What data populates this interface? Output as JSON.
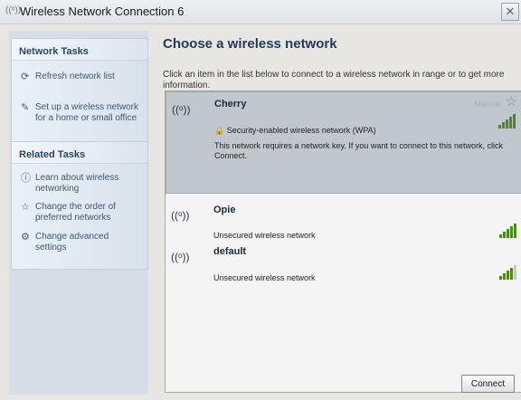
{
  "window": {
    "title": "Wireless Network Connection 6",
    "close_glyph": "✕",
    "title_icon": "wireless-icon"
  },
  "sidebar": {
    "network_tasks": {
      "title": "Network Tasks",
      "items": [
        {
          "label": "Refresh network list",
          "icon": "refresh-icon"
        },
        {
          "label": "Set up a wireless network for a home or small office",
          "icon": "setup-icon"
        }
      ]
    },
    "related_tasks": {
      "title": "Related Tasks",
      "items": [
        {
          "label": "Learn about wireless networking",
          "icon": "info-icon"
        },
        {
          "label": "Change the order of preferred networks",
          "icon": "star-icon"
        },
        {
          "label": "Change advanced settings",
          "icon": "gear-icon"
        }
      ]
    }
  },
  "main": {
    "title": "Choose a wireless network",
    "instructions": "Click an item in the list below to connect to a wireless network in range or to get more information.",
    "networks": [
      {
        "name": "Cherry",
        "status": "Security-enabled wireless network (WPA)",
        "description": "This network requires a network key. If you want to connect to this network, click Connect.",
        "manual_label": "Manual",
        "signal_bars": 5,
        "selected": true
      },
      {
        "name": "Opie",
        "status": "Unsecured wireless network",
        "signal_bars": 5,
        "selected": false
      },
      {
        "name": "default",
        "status": "Unsecured wireless network",
        "signal_bars": 4,
        "selected": false
      }
    ],
    "connect_label": "Connect"
  },
  "colors": {
    "accent": "#2a4669",
    "selected_row": "#c1c8cd",
    "signal": "#4d8a1e"
  }
}
